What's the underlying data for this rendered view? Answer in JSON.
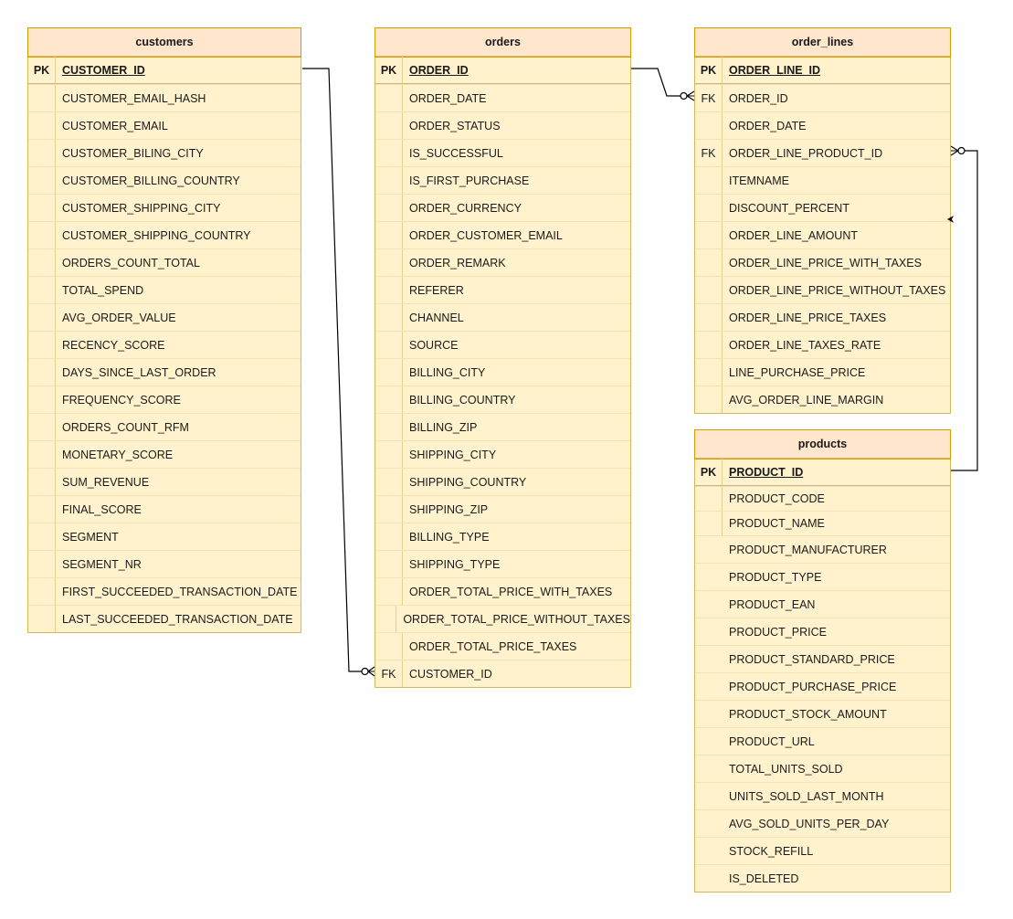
{
  "tables": {
    "customers": {
      "title": "customers",
      "rows": [
        {
          "key": "PK",
          "name": "CUSTOMER_ID"
        },
        {
          "key": "",
          "name": "CUSTOMER_EMAIL_HASH"
        },
        {
          "key": "",
          "name": "CUSTOMER_EMAIL"
        },
        {
          "key": "",
          "name": "CUSTOMER_BILING_CITY"
        },
        {
          "key": "",
          "name": "CUSTOMER_BILLING_COUNTRY"
        },
        {
          "key": "",
          "name": "CUSTOMER_SHIPPING_CITY"
        },
        {
          "key": "",
          "name": "CUSTOMER_SHIPPING_COUNTRY"
        },
        {
          "key": "",
          "name": "ORDERS_COUNT_TOTAL"
        },
        {
          "key": "",
          "name": "TOTAL_SPEND"
        },
        {
          "key": "",
          "name": "AVG_ORDER_VALUE"
        },
        {
          "key": "",
          "name": "RECENCY_SCORE"
        },
        {
          "key": "",
          "name": "DAYS_SINCE_LAST_ORDER"
        },
        {
          "key": "",
          "name": "FREQUENCY_SCORE"
        },
        {
          "key": "",
          "name": "ORDERS_COUNT_RFM"
        },
        {
          "key": "",
          "name": "MONETARY_SCORE"
        },
        {
          "key": "",
          "name": "SUM_REVENUE"
        },
        {
          "key": "",
          "name": "FINAL_SCORE"
        },
        {
          "key": "",
          "name": "SEGMENT"
        },
        {
          "key": "",
          "name": "SEGMENT_NR"
        },
        {
          "key": "",
          "name": "FIRST_SUCCEEDED_TRANSACTION_DATE"
        },
        {
          "key": "",
          "name": "LAST_SUCCEEDED_TRANSACTION_DATE"
        }
      ]
    },
    "orders": {
      "title": "orders",
      "rows": [
        {
          "key": "PK",
          "name": "ORDER_ID"
        },
        {
          "key": "",
          "name": "ORDER_DATE"
        },
        {
          "key": "",
          "name": "ORDER_STATUS"
        },
        {
          "key": "",
          "name": "IS_SUCCESSFUL"
        },
        {
          "key": "",
          "name": "IS_FIRST_PURCHASE"
        },
        {
          "key": "",
          "name": "ORDER_CURRENCY"
        },
        {
          "key": "",
          "name": "ORDER_CUSTOMER_EMAIL"
        },
        {
          "key": "",
          "name": "ORDER_REMARK"
        },
        {
          "key": "",
          "name": "REFERER"
        },
        {
          "key": "",
          "name": "CHANNEL"
        },
        {
          "key": "",
          "name": "SOURCE"
        },
        {
          "key": "",
          "name": "BILLING_CITY"
        },
        {
          "key": "",
          "name": "BILLING_COUNTRY"
        },
        {
          "key": "",
          "name": "BILLING_ZIP"
        },
        {
          "key": "",
          "name": "SHIPPING_CITY"
        },
        {
          "key": "",
          "name": "SHIPPING_COUNTRY"
        },
        {
          "key": "",
          "name": "SHIPPING_ZIP"
        },
        {
          "key": "",
          "name": "BILLING_TYPE"
        },
        {
          "key": "",
          "name": "SHIPPING_TYPE"
        },
        {
          "key": "",
          "name": "ORDER_TOTAL_PRICE_WITH_TAXES"
        },
        {
          "key": "",
          "name": "ORDER_TOTAL_PRICE_WITHOUT_TAXES"
        },
        {
          "key": "",
          "name": "ORDER_TOTAL_PRICE_TAXES"
        },
        {
          "key": "FK",
          "name": "CUSTOMER_ID"
        }
      ]
    },
    "order_lines": {
      "title": "order_lines",
      "rows": [
        {
          "key": "PK",
          "name": "ORDER_LINE_ID"
        },
        {
          "key": "FK",
          "name": "ORDER_ID"
        },
        {
          "key": "",
          "name": "ORDER_DATE"
        },
        {
          "key": "FK",
          "name": "ORDER_LINE_PRODUCT_ID"
        },
        {
          "key": "",
          "name": "ITEMNAME"
        },
        {
          "key": "",
          "name": "DISCOUNT_PERCENT"
        },
        {
          "key": "",
          "name": "ORDER_LINE_AMOUNT"
        },
        {
          "key": "",
          "name": "ORDER_LINE_PRICE_WITH_TAXES"
        },
        {
          "key": "",
          "name": "ORDER_LINE_PRICE_WITHOUT_TAXES"
        },
        {
          "key": "",
          "name": "ORDER_LINE_PRICE_TAXES"
        },
        {
          "key": "",
          "name": "ORDER_LINE_TAXES_RATE"
        },
        {
          "key": "",
          "name": "LINE_PURCHASE_PRICE"
        },
        {
          "key": "",
          "name": "AVG_ORDER_LINE_MARGIN"
        }
      ]
    },
    "products": {
      "title": "products",
      "rows": [
        {
          "key": "PK",
          "name": "PRODUCT_ID"
        },
        {
          "key": "",
          "name": "PRODUCT_CODE"
        },
        {
          "key": "",
          "name": "PRODUCT_NAME"
        },
        {
          "key": "",
          "name": "PRODUCT_MANUFACTURER"
        },
        {
          "key": "",
          "name": "PRODUCT_TYPE"
        },
        {
          "key": "",
          "name": "PRODUCT_EAN"
        },
        {
          "key": "",
          "name": "PRODUCT_PRICE"
        },
        {
          "key": "",
          "name": "PRODUCT_STANDARD_PRICE"
        },
        {
          "key": "",
          "name": "PRODUCT_PURCHASE_PRICE"
        },
        {
          "key": "",
          "name": "PRODUCT_STOCK_AMOUNT"
        },
        {
          "key": "",
          "name": "PRODUCT_URL"
        },
        {
          "key": "",
          "name": "TOTAL_UNITS_SOLD"
        },
        {
          "key": "",
          "name": "UNITS_SOLD_LAST_MONTH"
        },
        {
          "key": "",
          "name": "AVG_SOLD_UNITS_PER_DAY"
        },
        {
          "key": "",
          "name": "STOCK_REFILL"
        },
        {
          "key": "",
          "name": "IS_DELETED"
        }
      ]
    }
  },
  "relationships": [
    {
      "from": "customers.CUSTOMER_ID",
      "to": "orders.CUSTOMER_ID",
      "cardinality": "one-to-zero-or-many"
    },
    {
      "from": "orders.ORDER_ID",
      "to": "order_lines.ORDER_ID",
      "cardinality": "one-to-zero-or-many"
    },
    {
      "from": "products.PRODUCT_ID",
      "to": "order_lines.ORDER_LINE_PRODUCT_ID",
      "cardinality": "one-to-zero-or-many"
    }
  ],
  "colors": {
    "header_fill": "#ffe6cc",
    "header_stroke": "#d79b00",
    "body_fill": "#fff2cc",
    "body_stroke": "#d6b656",
    "line": "#000000"
  }
}
